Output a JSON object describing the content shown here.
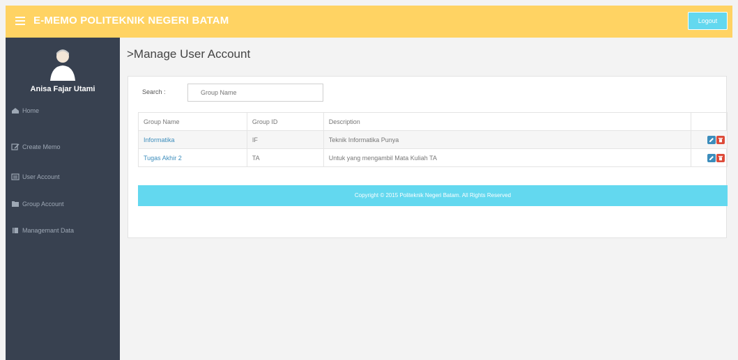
{
  "header": {
    "title": "E-MEMO POLITEKNIK NEGERI BATAM",
    "logout_label": "Logout"
  },
  "sidebar": {
    "user_name": "Anisa Fajar Utami",
    "items": [
      {
        "label": "Home",
        "icon": "home-icon"
      },
      {
        "label": "Create Memo",
        "icon": "edit-icon"
      },
      {
        "label": "User Account",
        "icon": "user-list-icon"
      },
      {
        "label": "Group Account",
        "icon": "group-icon"
      },
      {
        "label": "Managemant Data",
        "icon": "book-icon"
      }
    ]
  },
  "page": {
    "title": ">Manage User Account"
  },
  "search": {
    "label": "Search :",
    "placeholder": "Group Name"
  },
  "table": {
    "columns": [
      "Group Name",
      "Group ID",
      "Description",
      ""
    ],
    "rows": [
      {
        "group_name": "Informatika",
        "group_id": "IF",
        "description": "Teknik Informatika Punya"
      },
      {
        "group_name": "Tugas Akhir 2",
        "group_id": "TA",
        "description": "Untuk yang mengambil Mata Kuliah TA"
      }
    ]
  },
  "footer": {
    "text": "Copyright © 2015 Politeknik Negeri Batam. All Rights Reserved"
  },
  "colors": {
    "header": "#ffd363",
    "sidebar": "#384150",
    "accent": "#63d8ef",
    "edit": "#3c8dbc",
    "delete": "#dd4b39"
  }
}
